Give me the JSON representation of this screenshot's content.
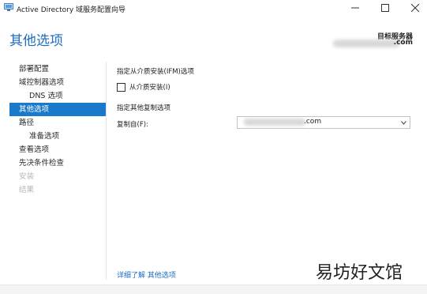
{
  "window": {
    "title": "Active Directory 域服务配置向导"
  },
  "header": {
    "page_title": "其他选项",
    "target_label": "目标服务器",
    "target_server_suffix": ".com"
  },
  "nav": {
    "items": [
      {
        "label": "部署配置"
      },
      {
        "label": "域控制器选项"
      },
      {
        "label": "DNS 选项"
      },
      {
        "label": "其他选项"
      },
      {
        "label": "路径"
      },
      {
        "label": "准备选项"
      },
      {
        "label": "查看选项"
      },
      {
        "label": "先决条件检查"
      },
      {
        "label": "安装"
      },
      {
        "label": "结果"
      }
    ]
  },
  "main": {
    "ifm_section_label": "指定从介质安装(IFM)选项",
    "ifm_checkbox_label": "从介质安装(I)",
    "ifm_checked": false,
    "replication_section_label": "指定其他复制选项",
    "copy_from_label": "复制自(F):",
    "copy_from_value": ".com"
  },
  "footer": {
    "help_link": "详细了解 其他选项",
    "watermark": "易坊好文馆"
  },
  "colors": {
    "accent": "#1979ca",
    "title_blue": "#1f6cbf",
    "disabled": "#b8b8b8"
  }
}
